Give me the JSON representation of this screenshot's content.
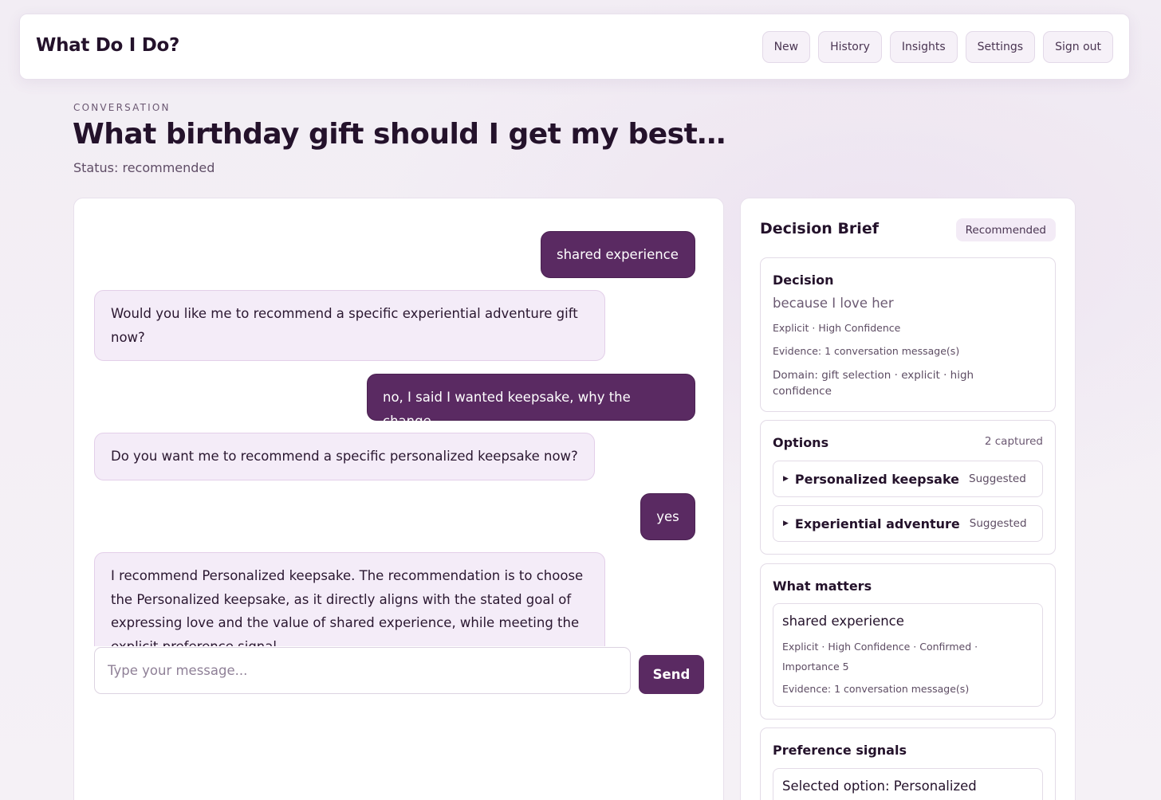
{
  "app": {
    "title": "What Do I Do?"
  },
  "nav": [
    "New",
    "History",
    "Insights",
    "Settings",
    "Sign out"
  ],
  "page": {
    "eyebrow": "CONVERSATION",
    "title": "What birthday gift should I get my best…",
    "status": "Status: recommended"
  },
  "chat": {
    "messages": [
      {
        "role": "user",
        "text": "shared experience"
      },
      {
        "role": "assistant",
        "text": "Would you like me to recommend a specific experiential adventure gift now?"
      },
      {
        "role": "user",
        "text": "no, I said I wanted keepsake, why the change"
      },
      {
        "role": "assistant",
        "text": "Do you want me to recommend a specific personalized keepsake now?"
      },
      {
        "role": "user",
        "text": "yes"
      },
      {
        "role": "assistant",
        "text": "I recommend Personalized keepsake. The recommendation is to choose the Personalized keepsake, as it directly aligns with the stated goal of expressing love and the value of shared experience, while meeting the explicit preference signal."
      }
    ],
    "input_placeholder": "Type your message...",
    "input_value": "",
    "send_label": "Send"
  },
  "brief": {
    "title": "Decision Brief",
    "badge": "Recommended",
    "decision": {
      "title": "Decision",
      "value": "because I love her",
      "meta": "Explicit · High Confidence",
      "evidence": "Evidence: 1 conversation message(s)",
      "domain": "Domain: gift selection · explicit · high confidence"
    },
    "options": {
      "title": "Options",
      "count": "2 captured",
      "items": [
        {
          "label": "Personalized keepsake",
          "tag": "Suggested"
        },
        {
          "label": "Experiential adventure",
          "tag": "Suggested"
        }
      ]
    },
    "what_matters": {
      "title": "What matters",
      "item": {
        "label": "shared experience",
        "meta": "Explicit · High Confidence · Confirmed · Importance 5",
        "evidence": "Evidence: 1 conversation message(s)"
      }
    },
    "preference_signals": {
      "title": "Preference signals",
      "item": "Selected option: Personalized"
    }
  },
  "colors": {
    "accent": "#5a2a62",
    "bubble_bot": "#f4ecf8",
    "background": "#f3eef5"
  }
}
